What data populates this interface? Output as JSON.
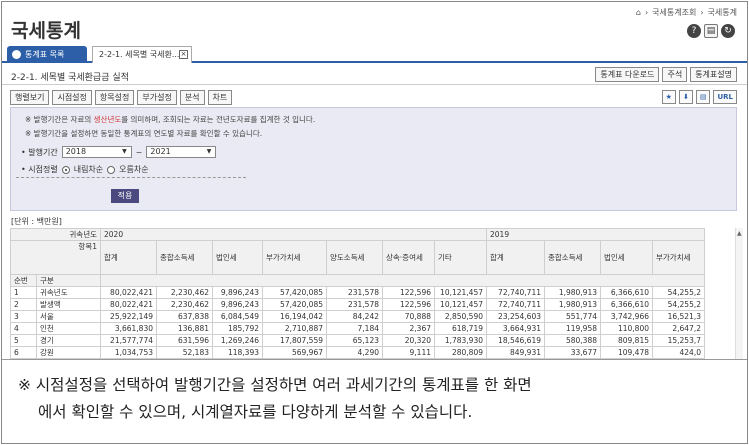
{
  "header": {
    "breadcrumb": [
      "국세통계조회",
      "국세통계"
    ],
    "title": "국세통계",
    "icons": [
      "help-icon",
      "print-icon",
      "refresh-icon"
    ]
  },
  "tabs": {
    "list_label": "통계표 목록",
    "doc_label": "2-2-1. 세목별 국세환..."
  },
  "page": {
    "subtitle": "2-2-1. 세목별 국세환급금 실적",
    "right_buttons": [
      "통계표 다운로드",
      "주석",
      "통계표설명"
    ],
    "menu": [
      "행렬보기",
      "시점설정",
      "항목설정",
      "부가설정",
      "분석",
      "차트"
    ],
    "export_icons": [
      "bookmark",
      "download",
      "print",
      "URL"
    ]
  },
  "panel": {
    "note1_prefix": "※ 발행기간은 자료의 ",
    "note1_red": "생산년도",
    "note1_suffix": "를 의미하며, 조회되는 자료는 전년도자료를 집계한 것 입니다.",
    "note2": "※ 발행기간을 설정하면 동일한 통계표의 연도별 자료를 확인할 수 있습니다.",
    "period_label": "• 발행기간",
    "period_from": "2018",
    "period_to": "2021",
    "sort_label": "• 시점정렬",
    "sort_desc": "내림차순",
    "sort_asc": "오름차순",
    "apply_label": "적용"
  },
  "table": {
    "unit": "[단위 : 백만원]",
    "year_col_header": "귀속년도",
    "item_header": "항목1",
    "row_header_num": "순번",
    "row_header_div": "구분",
    "years": [
      "2020",
      "2019"
    ],
    "columns_2020": [
      "합계",
      "종합소득세",
      "법인세",
      "부가가치세",
      "양도소득세",
      "상속·증여세",
      "기타"
    ],
    "columns_2019": [
      "합계",
      "종합소득세",
      "법인세",
      "부가가치세"
    ],
    "rows": [
      {
        "no": "1",
        "name": "귀속년도",
        "v2020": [
          "80,022,421",
          "2,230,462",
          "9,896,243",
          "57,420,085",
          "231,578",
          "122,596",
          "10,121,457"
        ],
        "v2019": [
          "72,740,711",
          "1,980,913",
          "6,366,610",
          "54,255,2"
        ]
      },
      {
        "no": "2",
        "name": "발생액",
        "v2020": [
          "80,022,421",
          "2,230,462",
          "9,896,243",
          "57,420,085",
          "231,578",
          "122,596",
          "10,121,457"
        ],
        "v2019": [
          "72,740,711",
          "1,980,913",
          "6,366,610",
          "54,255,2"
        ]
      },
      {
        "no": "3",
        "name": "서울",
        "v2020": [
          "25,922,149",
          "637,838",
          "6,084,549",
          "16,194,042",
          "84,242",
          "70,888",
          "2,850,590"
        ],
        "v2019": [
          "23,254,603",
          "551,774",
          "3,742,966",
          "16,521,3"
        ]
      },
      {
        "no": "4",
        "name": "인천",
        "v2020": [
          "3,661,830",
          "136,881",
          "185,792",
          "2,710,887",
          "7,184",
          "2,367",
          "618,719"
        ],
        "v2019": [
          "3,664,931",
          "119,958",
          "110,800",
          "2,647,2"
        ]
      },
      {
        "no": "5",
        "name": "경기",
        "v2020": [
          "21,577,774",
          "631,596",
          "1,269,246",
          "17,807,559",
          "65,123",
          "20,320",
          "1,783,930"
        ],
        "v2019": [
          "18,546,619",
          "580,388",
          "809,815",
          "15,253,7"
        ]
      },
      {
        "no": "6",
        "name": "강원",
        "v2020": [
          "1,034,753",
          "52,183",
          "118,393",
          "569,967",
          "4,290",
          "9,111",
          "280,809"
        ],
        "v2019": [
          "849,931",
          "33,677",
          "109,478",
          "424,0"
        ]
      }
    ]
  },
  "caption": {
    "line1": "※ 시점설정을 선택하여 발행기간을 설정하면 여러 과세기간의 통계표를 한 화면",
    "line2": "에서 확인할 수 있으며, 시계열자료를 다양하게 분석할 수 있습니다."
  }
}
